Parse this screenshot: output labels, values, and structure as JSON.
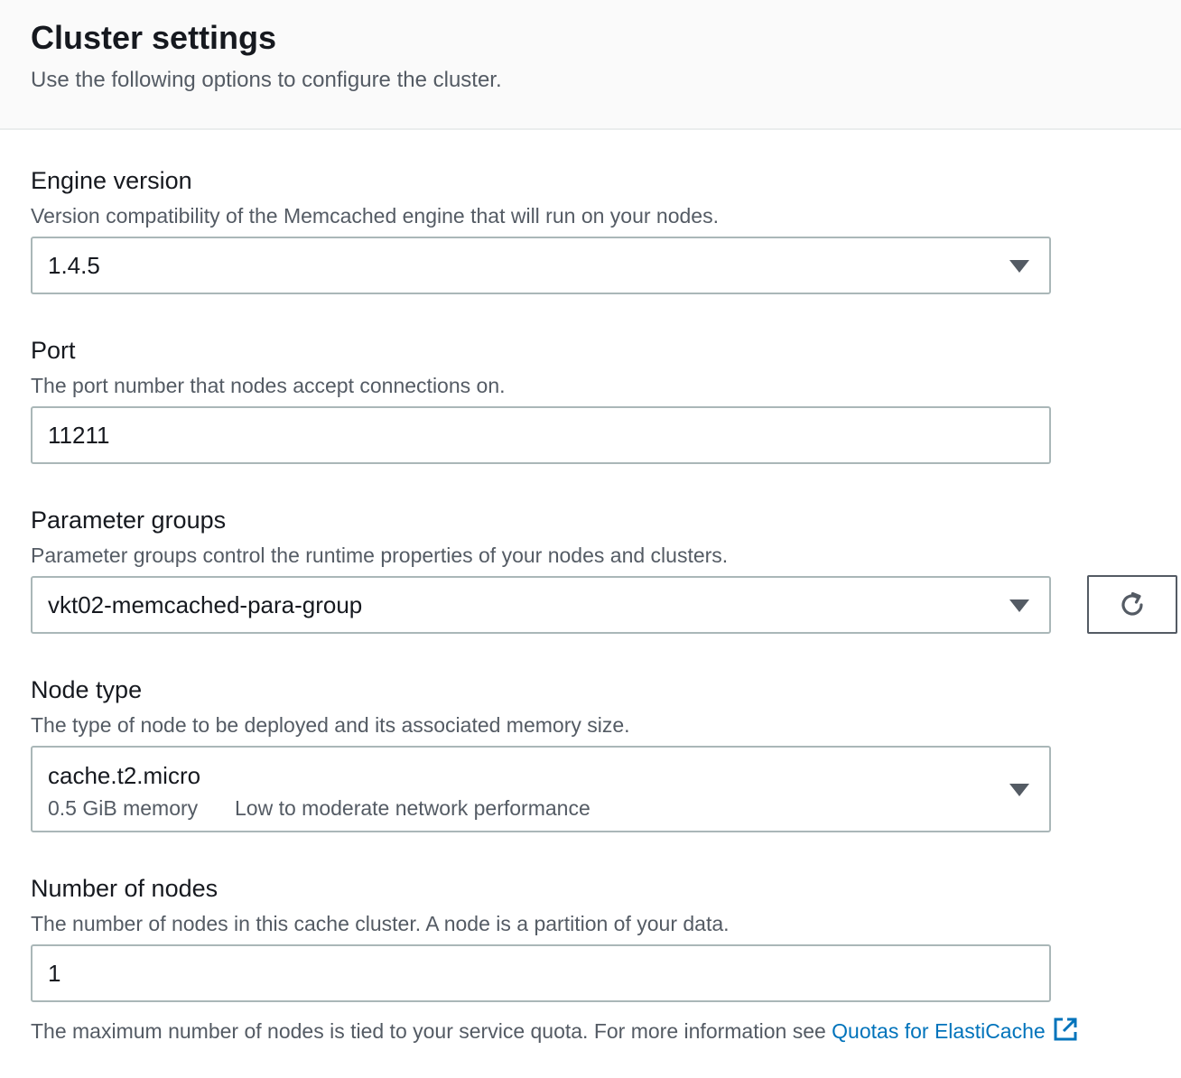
{
  "header": {
    "title": "Cluster settings",
    "description": "Use the following options to configure the cluster."
  },
  "engine_version": {
    "label": "Engine version",
    "description": "Version compatibility of the Memcached engine that will run on your nodes.",
    "selected": "1.4.5"
  },
  "port": {
    "label": "Port",
    "description": "The port number that nodes accept connections on.",
    "value": "11211"
  },
  "parameter_groups": {
    "label": "Parameter groups",
    "description": "Parameter groups control the runtime properties of your nodes and clusters.",
    "selected": "vkt02-memcached-para-group",
    "refresh_icon": "refresh-icon"
  },
  "node_type": {
    "label": "Node type",
    "description": "The type of node to be deployed and its associated memory size.",
    "selected": "cache.t2.micro",
    "memory": "0.5 GiB memory",
    "network": "Low to moderate network performance"
  },
  "number_of_nodes": {
    "label": "Number of nodes",
    "description": "The number of nodes in this cache cluster. A node is a partition of your data.",
    "value": "1"
  },
  "footer": {
    "note": "The maximum number of nodes is tied to your service quota. For more information see ",
    "link_text": "Quotas for ElastiCache",
    "link_icon": "external-link-icon"
  },
  "colors": {
    "link": "#0073bb",
    "border": "#aab7b8",
    "text_secondary": "#545b64"
  }
}
